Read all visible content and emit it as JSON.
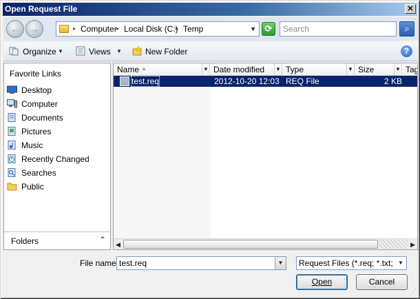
{
  "window": {
    "title": "Open Request File",
    "close_glyph": "✕"
  },
  "nav": {
    "back_glyph": "←",
    "forward_glyph": "→",
    "dropdown_glyph": "▾",
    "breadcrumb": [
      "Computer",
      "Local Disk (C:)",
      "Temp"
    ],
    "breadcrumb_sep": "▸",
    "address_dropdown_glyph": "▼",
    "refresh_glyph": "⟳",
    "search_placeholder": "Search",
    "search_glyph": "⌕"
  },
  "toolbar": {
    "organize": "Organize",
    "views": "Views",
    "new_folder": "New Folder",
    "arrow_glyph": "▼",
    "help_glyph": "?"
  },
  "left": {
    "header": "Favorite Links",
    "items": [
      {
        "label": "Desktop",
        "icon": "desktop-icon"
      },
      {
        "label": "Computer",
        "icon": "computer-icon"
      },
      {
        "label": "Documents",
        "icon": "documents-icon"
      },
      {
        "label": "Pictures",
        "icon": "pictures-icon"
      },
      {
        "label": "Music",
        "icon": "music-icon"
      },
      {
        "label": "Recently Changed",
        "icon": "recent-icon"
      },
      {
        "label": "Searches",
        "icon": "searches-icon"
      },
      {
        "label": "Public",
        "icon": "public-folder-icon"
      }
    ],
    "folders_label": "Folders",
    "folders_chevron": "⌃"
  },
  "files": {
    "columns": [
      "Name",
      "Date modified",
      "Type",
      "Size",
      "Tag"
    ],
    "sort_glyph": "▲",
    "col_dropdown_glyph": "▼",
    "rows": [
      {
        "name": "test.req",
        "date": "2012-10-20 12:03",
        "type": "REQ File",
        "size": "2 KB"
      }
    ],
    "scroll_left_glyph": "◀",
    "scroll_right_glyph": "▶"
  },
  "bottom": {
    "file_name_label": "File name:",
    "file_name_value": "test.req",
    "file_type_value": "Request Files (*.req; *.txt; *.cm",
    "open_label": "Open",
    "cancel_label": "Cancel",
    "drop_glyph": "▼",
    "grip_glyph": "⋰"
  },
  "colors": {
    "selection": "#0a246a",
    "title_bar": "#0a246a"
  }
}
